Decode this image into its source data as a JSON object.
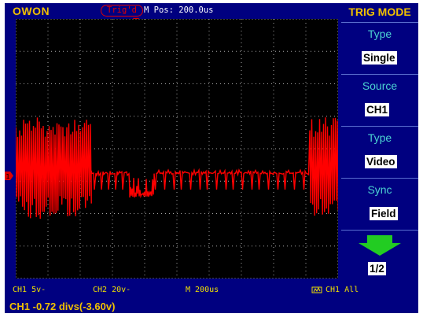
{
  "brand": "OWON",
  "trigger_status": "Trig'd",
  "m_pos": "M Pos: 200.0us",
  "menu": {
    "title": "TRIG MODE",
    "items": [
      {
        "label": "Type",
        "value": "Single"
      },
      {
        "label": "Source",
        "value": "CH1"
      },
      {
        "label": "Type",
        "value": "Video"
      },
      {
        "label": "Sync",
        "value": "Field"
      }
    ],
    "page": "1/2"
  },
  "bottom": {
    "ch1": "CH1 5v-",
    "ch2": "CH2 20v-",
    "timebase": "M 200us",
    "trig_source": "CH1 All"
  },
  "status_line": "CH1 -0.72 divs(-3.60v)",
  "colors": {
    "frame": "#000080",
    "screen": "#000000",
    "trace": "#ff0000",
    "menu_label": "#4bd2d2",
    "brand": "#f0c000"
  }
}
